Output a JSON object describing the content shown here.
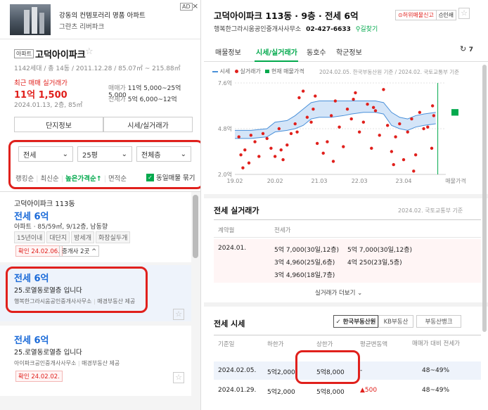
{
  "ad": {
    "badge": "AD",
    "close": "×",
    "title": "강동의 컨템포러리 명품 아파트",
    "subtitle": "그란츠 리버파크"
  },
  "complex": {
    "type_badge": "아파트",
    "name": "고덕아이파크",
    "info": "1142세대 / 총 14동 / 2011.12.28 / 85.07㎡ ~ 215.88㎡",
    "recent_label": "최근 매매 실거래가",
    "recent_price": "11억 1,500",
    "recent_date": "2024.01.13, 2층, 85㎡",
    "sale_label": "매매가",
    "sale_range": "11억 5,000~25억 5,000",
    "jeonse_label": "전세가",
    "jeonse_range": "5억 6,000~12억",
    "btn_info": "단지정보",
    "btn_price": "시세/실거래가"
  },
  "filters": {
    "trade": "전세",
    "area": "25평",
    "floor": "전체층",
    "sorts": [
      "랭킹순",
      "최신순",
      "높은가격순↑",
      "면적순"
    ],
    "active_sort": 2,
    "group_label": "동일매물 묶기"
  },
  "group_card": {
    "building": "고덕아이파크 113동",
    "price": "전세 6억",
    "spec": "아파트 · 85/59㎡, 9/12층, 남동향",
    "tags": [
      "15년이내",
      "대단지",
      "방세개",
      "화장실두개"
    ],
    "confirm": "확인 24.02.06.",
    "agents": "중개사 2곳 ^"
  },
  "listings": [
    {
      "price": "전세 6억",
      "desc": "25.로열동로열층 입니다",
      "agent": "행복한그라시움공인중개사사무소",
      "provider": "매경부동산 제공"
    },
    {
      "price": "전세 6억",
      "desc": "25.로열동로열층 입니다",
      "agent": "아이파크공인중개사사무소",
      "provider": "매경부동산 제공",
      "confirm": "확인 24.02.02."
    }
  ],
  "header": {
    "title": "고덕아이파크 113동 · 9층 · 전세 6억",
    "report_btn": "허위매물신고",
    "print_btn": "인쇄",
    "agent_line": "행복한그라시움공인중개사사무소",
    "phone": "02-427-6633",
    "directions": "길찾기"
  },
  "tabs": [
    "매물정보",
    "시세/실거래가",
    "동호수",
    "학군정보"
  ],
  "active_tab": 1,
  "refresh_icon": "refresh-icon",
  "chart_legend": {
    "items": [
      "시세",
      "실거래가",
      "현재 매물가격"
    ],
    "source": "2024.02.05. 한국부동산원 기준 / 2024.02. 국토교통부 기준"
  },
  "chart_data": {
    "type": "line",
    "ylim": [
      2.0,
      7.6
    ],
    "yticks": [
      "7.6억",
      "4.8억",
      "2.0억"
    ],
    "xticks": [
      "19.02",
      "20.02",
      "21.03",
      "22.03",
      "23.04",
      "매물가격"
    ],
    "xrange": [
      2019.1,
      2024.35
    ],
    "band": {
      "x": [
        2019.1,
        2019.5,
        2019.9,
        2020.1,
        2020.4,
        2020.6,
        2020.8,
        2021.0,
        2021.2,
        2021.5,
        2021.8,
        2022.0,
        2022.3,
        2022.6,
        2022.8,
        2023.0,
        2023.2,
        2023.4,
        2023.6,
        2023.8,
        2024.1
      ],
      "lower": [
        4.2,
        4.2,
        4.3,
        4.6,
        4.7,
        4.8,
        5.0,
        5.4,
        5.5,
        5.5,
        5.6,
        5.7,
        5.8,
        5.8,
        5.7,
        5.0,
        4.8,
        4.7,
        4.9,
        5.0,
        5.1
      ],
      "upper": [
        4.7,
        4.7,
        4.8,
        5.2,
        5.3,
        5.6,
        6.0,
        6.4,
        6.5,
        6.5,
        6.5,
        6.5,
        6.5,
        6.5,
        6.4,
        5.8,
        5.5,
        5.4,
        5.6,
        5.7,
        5.8
      ]
    },
    "deals": {
      "x": [
        2019.2,
        2019.3,
        2019.35,
        2019.5,
        2019.6,
        2019.7,
        2019.8,
        2019.9,
        2020.0,
        2020.1,
        2020.2,
        2020.3,
        2020.4,
        2020.5,
        2020.6,
        2020.7,
        2020.8,
        2020.9,
        2021.0,
        2021.1,
        2021.15,
        2021.3,
        2021.4,
        2021.5,
        2021.6,
        2021.7,
        2021.8,
        2021.9,
        2022.0,
        2022.1,
        2022.2,
        2022.3,
        2022.4,
        2022.5,
        2022.6,
        2022.7,
        2022.8,
        2022.9,
        2023.0,
        2023.1,
        2023.2,
        2023.3,
        2023.4,
        2023.5,
        2023.6,
        2023.7,
        2023.8,
        2023.9,
        2024.0,
        2024.05,
        2019.25,
        2019.45,
        2020.25,
        2020.65,
        2021.05,
        2021.55,
        2022.05,
        2022.55,
        2023.05,
        2023.55,
        2024.02
      ],
      "y": [
        4.3,
        2.4,
        3.5,
        4.4,
        4.0,
        3.1,
        4.5,
        4.2,
        3.6,
        3.1,
        4.8,
        2.9,
        3.8,
        4.5,
        5.1,
        6.7,
        7.1,
        5.5,
        5.2,
        6.8,
        3.9,
        3.3,
        4.0,
        5.6,
        6.5,
        4.9,
        3.7,
        6.0,
        5.4,
        7.0,
        4.6,
        5.2,
        6.3,
        3.6,
        5.9,
        4.4,
        7.2,
        5.0,
        3.4,
        4.3,
        5.1,
        2.9,
        4.6,
        5.4,
        3.2,
        5.8,
        4.8,
        4.9,
        3.6,
        5.6,
        3.2,
        2.7,
        3.5,
        4.6,
        6.0,
        2.8,
        6.6,
        6.1,
        2.6,
        2.2,
        6.2
      ]
    },
    "current_listing": [
      5.6,
      6.0
    ]
  },
  "jeonse_deals": {
    "title": "전세 실거래가",
    "source": "2024.02. 국토교통부 기준",
    "col_month": "계약월",
    "col_price": "전세가",
    "month": "2024.01.",
    "entries": [
      "5억 7,000(30일,12층)",
      "5억 7,000(30일,12층)",
      "3억 4,960(25일,6층)",
      "4억 250(23일,5층)",
      "3억 4,960(18일,7층)"
    ],
    "more": "실거래가 더보기 ⌄"
  },
  "jeonse_price": {
    "title": "전세 시세",
    "providers": [
      "✓ 한국부동산원",
      "KB부동산",
      "부동산뱅크"
    ],
    "active_provider": 0,
    "headers": [
      "기준일",
      "하한가",
      "상한가",
      "평균변동액",
      "매매가 대비 전세가"
    ],
    "rows": [
      {
        "date": "2024.02.05.",
        "low": "5억2,000",
        "high": "5억8,000",
        "change": "-",
        "ratio": "48~49%"
      },
      {
        "date": "2024.01.29.",
        "low": "5억2,000",
        "high": "5억8,000",
        "change": "▲500",
        "ratio": "48~49%"
      }
    ]
  },
  "colors": {
    "accent_green": "#03a94d",
    "outline_red": "#e0201c",
    "link_blue": "#1a6ad8",
    "deal_red": "#e0201c",
    "band_blue": "#cfe2f7"
  }
}
